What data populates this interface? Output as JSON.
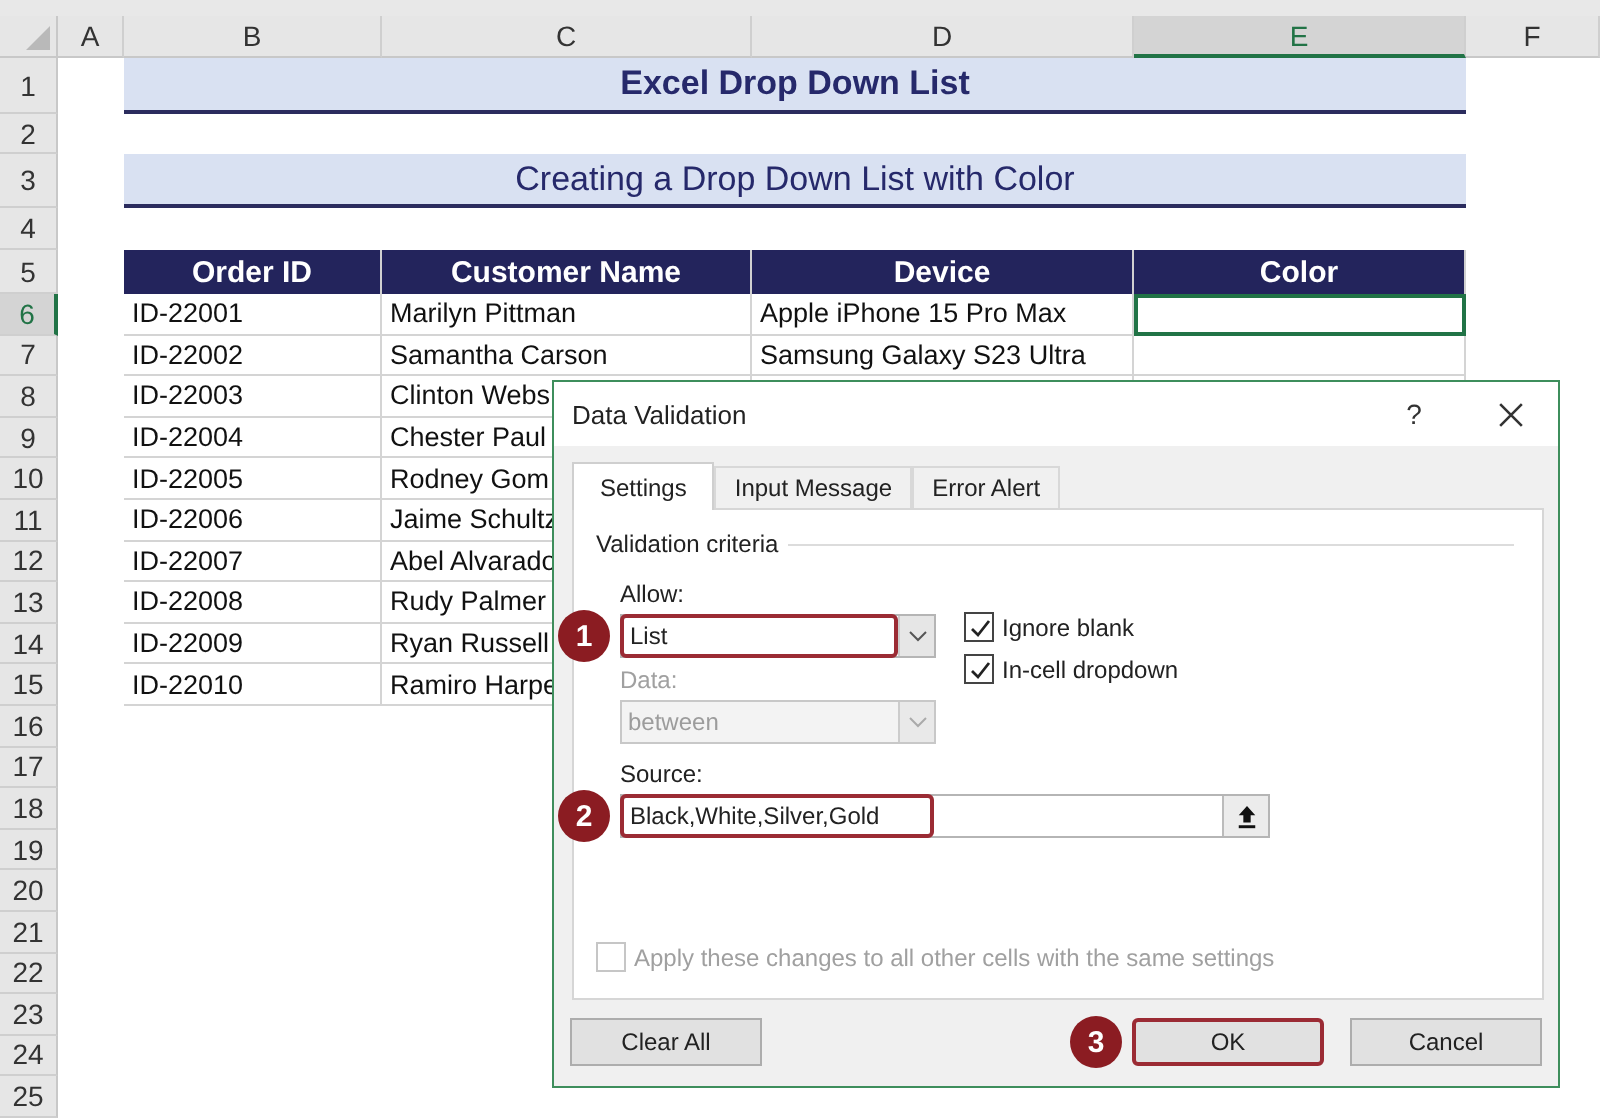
{
  "sheet": {
    "column_headers": [
      {
        "label": "A",
        "selected": false
      },
      {
        "label": "B",
        "selected": false
      },
      {
        "label": "C",
        "selected": false
      },
      {
        "label": "D",
        "selected": false
      },
      {
        "label": "E",
        "selected": true
      },
      {
        "label": "F",
        "selected": false
      }
    ],
    "row_headers": [
      {
        "label": "1",
        "selected": false
      },
      {
        "label": "2",
        "selected": false
      },
      {
        "label": "3",
        "selected": false
      },
      {
        "label": "4",
        "selected": false
      },
      {
        "label": "5",
        "selected": false
      },
      {
        "label": "6",
        "selected": true
      },
      {
        "label": "7",
        "selected": false
      },
      {
        "label": "8",
        "selected": false
      },
      {
        "label": "9",
        "selected": false
      },
      {
        "label": "10",
        "selected": false
      },
      {
        "label": "11",
        "selected": false
      },
      {
        "label": "12",
        "selected": false
      },
      {
        "label": "13",
        "selected": false
      },
      {
        "label": "14",
        "selected": false
      },
      {
        "label": "15",
        "selected": false
      },
      {
        "label": "16",
        "selected": false
      },
      {
        "label": "17",
        "selected": false
      },
      {
        "label": "18",
        "selected": false
      },
      {
        "label": "19",
        "selected": false
      },
      {
        "label": "20",
        "selected": false
      },
      {
        "label": "21",
        "selected": false
      },
      {
        "label": "22",
        "selected": false
      },
      {
        "label": "23",
        "selected": false
      },
      {
        "label": "24",
        "selected": false
      },
      {
        "label": "25",
        "selected": false
      }
    ],
    "title": "Excel Drop Down List",
    "subtitle": "Creating a Drop Down List with Color",
    "table": {
      "columns": [
        "Order ID",
        "Customer Name",
        "Device",
        "Color"
      ],
      "rows": [
        {
          "order_id": "ID-22001",
          "customer_name": "Marilyn Pittman",
          "device": "Apple iPhone 15 Pro Max",
          "selected": true
        },
        {
          "order_id": "ID-22002",
          "customer_name": "Samantha Carson",
          "device": "Samsung Galaxy S23 Ultra",
          "selected": false
        },
        {
          "order_id": "ID-22003",
          "customer_name": "Clinton Webs",
          "selected": false
        },
        {
          "order_id": "ID-22004",
          "customer_name": "Chester Paul",
          "selected": false
        },
        {
          "order_id": "ID-22005",
          "customer_name": "Rodney Gom",
          "selected": false
        },
        {
          "order_id": "ID-22006",
          "customer_name": "Jaime Schultz",
          "selected": false
        },
        {
          "order_id": "ID-22007",
          "customer_name": "Abel Alvarado",
          "selected": false
        },
        {
          "order_id": "ID-22008",
          "customer_name": "Rudy Palmer",
          "selected": false
        },
        {
          "order_id": "ID-22009",
          "customer_name": "Ryan Russell",
          "selected": false
        },
        {
          "order_id": "ID-22010",
          "customer_name": "Ramiro Harpe",
          "selected": false
        }
      ]
    }
  },
  "dialog": {
    "title": "Data Validation",
    "help": "?",
    "tabs": [
      {
        "label": "Settings",
        "selected": true
      },
      {
        "label": "Input Message",
        "selected": false
      },
      {
        "label": "Error Alert",
        "selected": false
      }
    ],
    "group_label": "Validation criteria",
    "allow": {
      "label": "Allow:",
      "value": "List",
      "disabled": false,
      "callout": "1"
    },
    "data": {
      "label": "Data:",
      "value": "between",
      "disabled": true
    },
    "checkboxes": [
      {
        "label": "Ignore blank",
        "checked": true,
        "disabled": false
      },
      {
        "label": "In-cell dropdown",
        "checked": true,
        "disabled": false
      }
    ],
    "source": {
      "label": "Source:",
      "value": "Black,White,Silver,Gold",
      "callout": "2"
    },
    "apply": {
      "label": "Apply these changes to all other cells with the same settings",
      "checked": false,
      "disabled": true
    },
    "buttons": [
      {
        "label": "Clear All"
      },
      {
        "label": "OK",
        "callout": "3"
      },
      {
        "label": "Cancel"
      }
    ]
  }
}
